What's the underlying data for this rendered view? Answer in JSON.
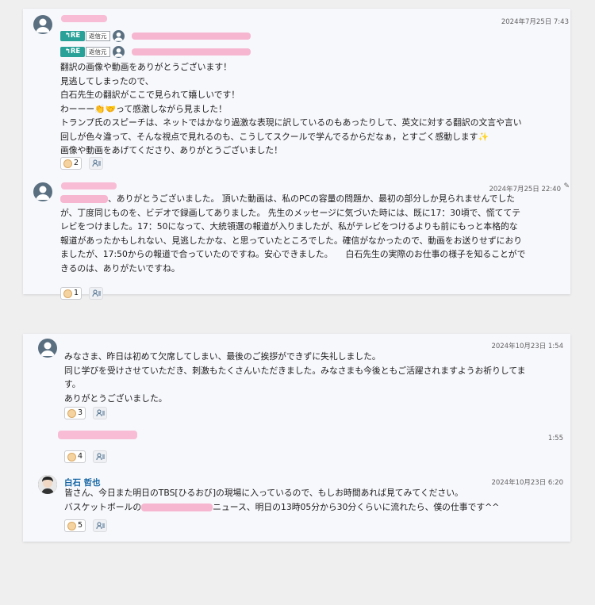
{
  "thread1": {
    "msg1": {
      "time": "2024年7月25日 7:43",
      "reply_tag": "RE",
      "reply_source": "返信元",
      "lines": [
        "翻訳の画像や動画をありがとうございます！",
        "見逃してしまったので、",
        "白石先生の翻訳がここで見られて嬉しいです！",
        "わーーー👏🤝って感激しながら見ました！",
        "トランプ氏のスピーチは、ネットではかなり過激な表現に訳しているのもあったりして、英文に対する翻訳の文言や言い",
        "回しが色々違って、そんな視点で見れるのも、こうしてスクールで学んでるからだなぁ，とすごく感動します✨",
        "画像や動画をあげてくださり、ありがとうございました！"
      ],
      "reaction_count": "2"
    },
    "msg2": {
      "time": "2024年7月25日 22:40",
      "line1_tail": "、ありがとうございました。 頂いた動画は、私のPCの容量の問題か、最初の部分しか見られませんでした",
      "lines": [
        "が、丁度同じものを、ビデオで録画してありました。 先生のメッセージに気づいた時には、既に17：30頃で、慌ててテ",
        "レビをつけました。17：50になって、大統領選の報道が入りましたが、私がテレビをつけるよりも前にもっと本格的な",
        "報道があったかもしれない、見逃したかな、と思っていたところでした。確信がなかったので、動画をお送りせずにおり",
        "ましたが、17:50からの報道で合っていたのですね。安心できました。　　白石先生の実際のお仕事の様子を知ることがで",
        "きるのは、ありがたいですね。"
      ],
      "reaction_count": "1"
    }
  },
  "thread2": {
    "msg1": {
      "time": "2024年10月23日 1:54",
      "lines": [
        "みなさま、昨日は初めて欠席してしまい、最後のご挨拶ができずに失礼しました。",
        "同じ学びを受けさせていただき、刺激もたくさんいただきました。みなさまも今後ともご活躍されますようお祈りしてま",
        "す。",
        "ありがとうございました。"
      ],
      "reaction_count": "3"
    },
    "msg2": {
      "time": "1:55",
      "reaction_count": "4"
    },
    "msg3": {
      "name": "白石 哲也",
      "time": "2024年10月23日 6:20",
      "line1": "皆さん、今日また明日のTBS[ひるおび]の現場に入っているので、もしお時間あれば見てみてください。",
      "line2_head": "バスケットボールの",
      "line2_tail": "ニュース、明日の13時05分から30分くらいに流れたら、僕の仕事です^^",
      "reaction_count": "5"
    }
  },
  "colors": {
    "background": "#efeff0",
    "card": "#f7f8fc",
    "re_badge": "#2aa198",
    "name_link": "#1264a3",
    "redaction": "#f7b6cf"
  },
  "icons": [
    "user-avatar-icon",
    "reply-arrow-icon",
    "add-reaction-icon",
    "edit-pencil-icon"
  ]
}
